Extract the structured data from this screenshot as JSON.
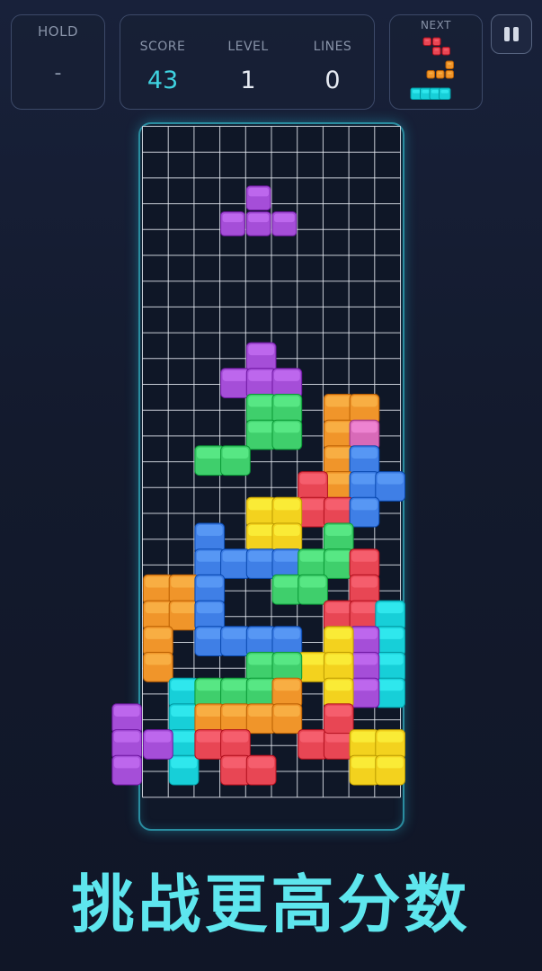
{
  "hold": {
    "label": "HOLD",
    "value": "-"
  },
  "stats": [
    {
      "key": "score",
      "label": "SCORE",
      "value": "43"
    },
    {
      "key": "level",
      "label": "LEVEL",
      "value": "1"
    },
    {
      "key": "lines",
      "label": "LINES",
      "value": "0"
    }
  ],
  "next": {
    "label": "NEXT",
    "pieces": [
      {
        "color": "red",
        "blocks": [
          [
            0,
            0
          ],
          [
            1,
            0
          ],
          [
            1,
            1
          ],
          [
            2,
            1
          ]
        ]
      },
      {
        "color": "orange",
        "blocks": [
          [
            2,
            0
          ],
          [
            0,
            1
          ],
          [
            1,
            1
          ],
          [
            2,
            1
          ]
        ]
      },
      {
        "color": "cyan",
        "blocks": [
          [
            0,
            0
          ],
          [
            1,
            0
          ],
          [
            2,
            0
          ],
          [
            3,
            0
          ]
        ]
      }
    ]
  },
  "pause_icon": "pause-icon",
  "slogan": "挑战更高分数",
  "colors": {
    "purple": "#a54ed8",
    "green": "#3fcf6c",
    "orange": "#f0952a",
    "yellow": "#f3d21e",
    "blue": "#3f7fe6",
    "red": "#e84654",
    "cyan": "#17cfd8",
    "pink": "#d86ab8",
    "grid": "#e8ecf4",
    "board_bg": "#0f1727",
    "accent": "#3fd2e0"
  },
  "board": {
    "cols": 10,
    "rows": 26,
    "falling_piece": [
      [
        4,
        2,
        "purple"
      ],
      [
        3,
        3,
        "purple"
      ],
      [
        4,
        3,
        "purple"
      ],
      [
        5,
        3,
        "purple"
      ]
    ],
    "cells": [
      [
        4,
        8,
        "purple"
      ],
      [
        3,
        9,
        "purple"
      ],
      [
        4,
        9,
        "purple"
      ],
      [
        5,
        9,
        "purple"
      ],
      [
        4,
        10,
        "green"
      ],
      [
        5,
        10,
        "green"
      ],
      [
        4,
        11,
        "green"
      ],
      [
        5,
        11,
        "green"
      ],
      [
        2,
        12,
        "green"
      ],
      [
        3,
        12,
        "green"
      ],
      [
        7,
        10,
        "orange"
      ],
      [
        8,
        10,
        "orange"
      ],
      [
        7,
        11,
        "orange"
      ],
      [
        8,
        11,
        "pink"
      ],
      [
        7,
        12,
        "orange"
      ],
      [
        8,
        12,
        "blue"
      ],
      [
        7,
        13,
        "orange"
      ],
      [
        8,
        13,
        "blue"
      ],
      [
        9,
        13,
        "blue"
      ],
      [
        6,
        13,
        "red"
      ],
      [
        6,
        14,
        "red"
      ],
      [
        7,
        14,
        "red"
      ],
      [
        8,
        14,
        "blue"
      ],
      [
        4,
        14,
        "yellow"
      ],
      [
        5,
        14,
        "yellow"
      ],
      [
        4,
        15,
        "yellow"
      ],
      [
        5,
        15,
        "yellow"
      ],
      [
        2,
        15,
        "blue"
      ],
      [
        2,
        16,
        "blue"
      ],
      [
        3,
        16,
        "blue"
      ],
      [
        4,
        16,
        "blue"
      ],
      [
        5,
        16,
        "blue"
      ],
      [
        7,
        15,
        "green"
      ],
      [
        6,
        16,
        "green"
      ],
      [
        7,
        16,
        "green"
      ],
      [
        5,
        17,
        "green"
      ],
      [
        6,
        17,
        "green"
      ],
      [
        8,
        16,
        "red"
      ],
      [
        8,
        17,
        "red"
      ],
      [
        7,
        18,
        "red"
      ],
      [
        8,
        18,
        "red"
      ],
      [
        0,
        17,
        "orange"
      ],
      [
        1,
        17,
        "orange"
      ],
      [
        0,
        18,
        "orange"
      ],
      [
        1,
        18,
        "orange"
      ],
      [
        0,
        19,
        "orange"
      ],
      [
        0,
        20,
        "orange"
      ],
      [
        2,
        17,
        "blue"
      ],
      [
        2,
        18,
        "blue"
      ],
      [
        2,
        19,
        "blue"
      ],
      [
        3,
        19,
        "blue"
      ],
      [
        4,
        19,
        "blue"
      ],
      [
        5,
        19,
        "blue"
      ],
      [
        9,
        18,
        "cyan"
      ],
      [
        9,
        19,
        "cyan"
      ],
      [
        9,
        20,
        "cyan"
      ],
      [
        9,
        21,
        "cyan"
      ],
      [
        8,
        19,
        "purple"
      ],
      [
        8,
        20,
        "purple"
      ],
      [
        8,
        21,
        "purple"
      ],
      [
        7,
        19,
        "yellow"
      ],
      [
        6,
        20,
        "yellow"
      ],
      [
        7,
        20,
        "yellow"
      ],
      [
        7,
        21,
        "yellow"
      ],
      [
        4,
        20,
        "green"
      ],
      [
        5,
        20,
        "green"
      ],
      [
        1,
        21,
        "cyan"
      ],
      [
        1,
        22,
        "cyan"
      ],
      [
        1,
        23,
        "cyan"
      ],
      [
        1,
        24,
        "cyan"
      ],
      [
        2,
        21,
        "green"
      ],
      [
        3,
        21,
        "green"
      ],
      [
        4,
        21,
        "green"
      ],
      [
        5,
        21,
        "orange"
      ],
      [
        2,
        22,
        "orange"
      ],
      [
        3,
        22,
        "orange"
      ],
      [
        4,
        22,
        "orange"
      ],
      [
        5,
        22,
        "orange"
      ],
      [
        -1,
        22,
        "purple"
      ],
      [
        -1,
        23,
        "purple"
      ],
      [
        0,
        23,
        "purple"
      ],
      [
        -1,
        24,
        "purple"
      ],
      [
        2,
        23,
        "red"
      ],
      [
        3,
        23,
        "red"
      ],
      [
        3,
        24,
        "red"
      ],
      [
        4,
        24,
        "red"
      ],
      [
        6,
        23,
        "red"
      ],
      [
        7,
        23,
        "red"
      ],
      [
        7,
        22,
        "red"
      ],
      [
        8,
        23,
        "yellow"
      ],
      [
        9,
        23,
        "yellow"
      ],
      [
        8,
        24,
        "yellow"
      ],
      [
        9,
        24,
        "yellow"
      ]
    ]
  }
}
